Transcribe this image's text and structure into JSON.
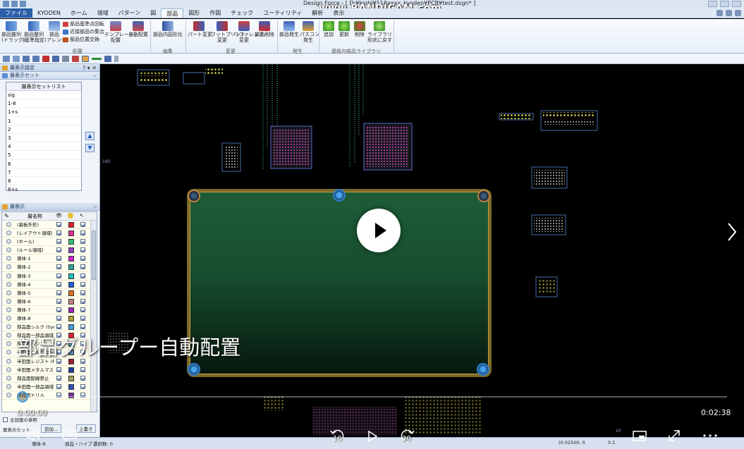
{
  "window": {
    "title": "Design Force - [ D:¥kiobi¥11Axxxx_kyoden¥PCB¥test.dsgn* ]",
    "watermark": "www.BANDICAM.com"
  },
  "tabs": [
    "ファイル",
    "KYODEN",
    "ホーム",
    "領域",
    "パターン",
    "図",
    "部品",
    "図形",
    "作図",
    "チェック",
    "ユーティリティ",
    "解析",
    "表示"
  ],
  "ribbon": {
    "haichi": {
      "big1": "部品整列\n(ドラッグ)",
      "big2": "部品整列\n(基準指定)",
      "big3": "部品\nアレンジ",
      "small1": "部品基準点回転",
      "small2": "近接部品の集合",
      "small3": "部品位置交換",
      "big4": "テンプレート\n配置",
      "big5": "自動配置",
      "label": "配置"
    },
    "henshu": {
      "big1": "部品内図形化",
      "label": "編集"
    },
    "henkou": {
      "big1": "パート変更",
      "big2": "フットプリント\n変更",
      "big3": "リファレンス\n変更",
      "big4": "部品削除",
      "label": "変更"
    },
    "hassei": {
      "big1": "部品発生",
      "big2": "パスコン\n発生",
      "label": "発生"
    },
    "library": {
      "big1": "追加",
      "big2": "更新",
      "big3": "削除",
      "big4": "ライブラリ\n形状に戻す",
      "label": "基板内部品ライブラリ"
    }
  },
  "leftpanel": {
    "title1": "層表示設定",
    "title2": "層表示セット",
    "listheader": "層表示セットリスト",
    "listitems": [
      "sig",
      "1-8",
      "1+s",
      "1",
      "2",
      "3",
      "4",
      "5",
      "6",
      "7",
      "8",
      "8+s"
    ],
    "title3": "層表示",
    "layerheader": "層名称",
    "layers": [
      {
        "name": "(基板外形)",
        "color": "#e0202c"
      },
      {
        "name": "(レイアウト領域)",
        "color": "#e030a0"
      },
      {
        "name": "(ホール)",
        "color": "#30c070"
      },
      {
        "name": "(ルール領域)",
        "color": "#9040c0"
      },
      {
        "name": "導体-1",
        "color": "#d020d0"
      },
      {
        "name": "導体-2",
        "color": "#30a0a0"
      },
      {
        "name": "導体-3",
        "color": "#20c0c0"
      },
      {
        "name": "導体-4",
        "color": "#2060e0"
      },
      {
        "name": "導体-5",
        "color": "#e07020"
      },
      {
        "name": "導体-6",
        "color": "#c08080"
      },
      {
        "name": "導体-7",
        "color": "#a020c0"
      },
      {
        "name": "導体-8",
        "color": "#b0a030"
      },
      {
        "name": "部品面シルク (Sym",
        "color": "#40a0e0"
      },
      {
        "name": "部品面ー部品領域",
        "color": "#e02030"
      },
      {
        "name": "部品面レジスト (Re",
        "color": "#60a0a0"
      },
      {
        "name": "半田面シルク (Sym",
        "color": "#6090c0"
      },
      {
        "name": "半田面レジスト (Re",
        "color": "#a02030"
      },
      {
        "name": "半田面メタルマスク",
        "color": "#2040a0"
      },
      {
        "name": "部品面配線禁止",
        "color": "#a0a060"
      },
      {
        "name": "半田面ー部品領域",
        "color": "#3050c0"
      },
      {
        "name": "部品面ドリル",
        "color": "#8030a0"
      }
    ],
    "checkbox_label": "全読層の参照",
    "bottom_btn1": "層表示セット",
    "bottom_btn2": "追加...",
    "bottom_btn3": "上書き"
  },
  "canvas": {
    "axis_tick_left": "180",
    "axis_tick_bottom": "20"
  },
  "video": {
    "caption": "部品グループー自動配置",
    "time_current": "0:00:00",
    "time_total": "0:02:38",
    "rewind_label": "10",
    "forward_label": "30"
  },
  "statusbar": {
    "layer": "導体-8",
    "mode": "部品・ハイブ",
    "selection": "選択数: 0",
    "coord": "(0.02500, 0",
    "zoom": "0.1"
  }
}
